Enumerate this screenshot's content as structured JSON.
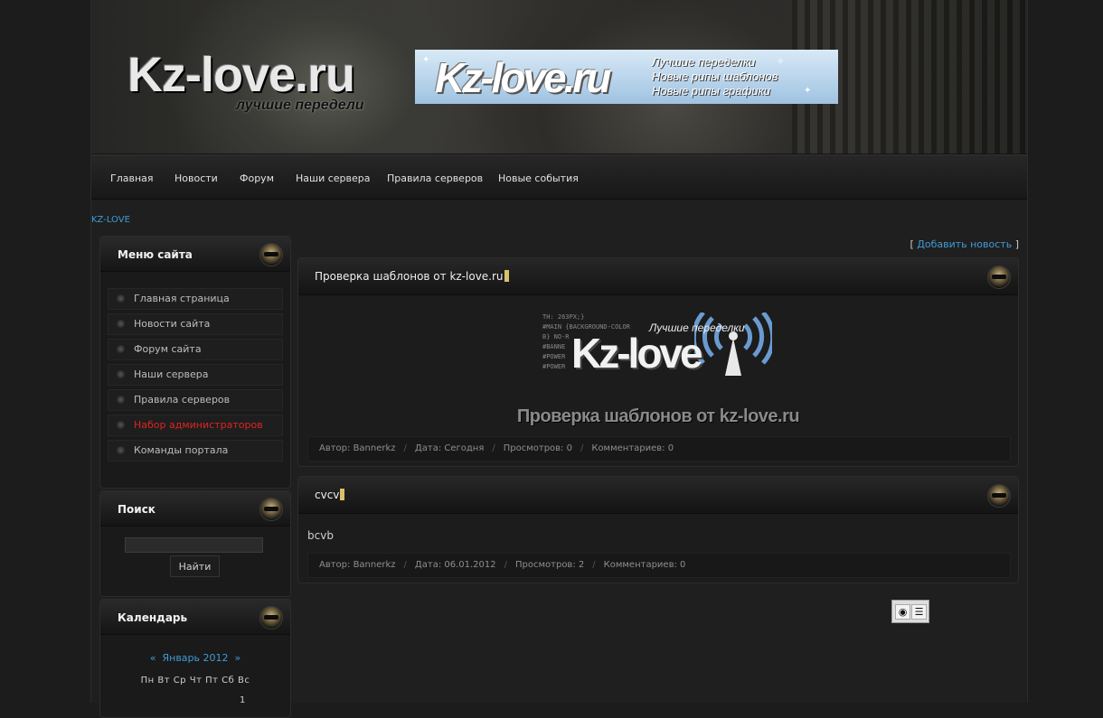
{
  "header": {
    "logo_text": "Kz-love.ru",
    "logo_subtitle": "лучшие передели",
    "banner": {
      "logo_text": "Kz-love.ru",
      "lines": [
        "Лучшие переделки",
        "Новые рипы шаблонов",
        "Новые рипы графики"
      ]
    }
  },
  "nav": {
    "items": [
      "Главная",
      "Новости",
      "Форум",
      "Наши сервера",
      "Правила серверов",
      "Новые события"
    ]
  },
  "breadcrumb": "KZ-LOVE",
  "sidebar": {
    "menu": {
      "title": "Меню сайта",
      "items": [
        {
          "label": "Главная страница"
        },
        {
          "label": "Новости сайта"
        },
        {
          "label": "Форум сайта"
        },
        {
          "label": "Наши сервера"
        },
        {
          "label": "Правила серверов"
        },
        {
          "label": "Набор администраторов",
          "color": "#e0241f"
        },
        {
          "label": "Команды портала"
        }
      ]
    },
    "search": {
      "title": "Поиск",
      "input_value": "",
      "button_label": "Найти"
    },
    "calendar": {
      "title": "Календарь",
      "prev": "«",
      "month": "Январь 2012",
      "next": "»",
      "weekdays": "Пн Вт Ср Чт Пт Сб Вс",
      "first_day": "1"
    }
  },
  "main": {
    "add_news_label": "Добавить новость",
    "posts": [
      {
        "title": "Проверка шаблонов от kz-love.ru",
        "image": {
          "logo": "Kz-love",
          "tagline": "Лучшие переделки",
          "code_lines": [
            "TH: 263PX;}",
            "#MAIN {BACKGROUND-COLOR",
            "B} NO-R",
            "#BANNE",
            "#POWER",
            "#POWER"
          ],
          "headline": "Проверка шаблонов от kz-love.ru"
        },
        "meta": {
          "author": "Автор: Bannerkz",
          "date": "Дата: Сегодня",
          "views": "Просмотров: 0",
          "comments": "Комментариев: 0"
        }
      },
      {
        "title": "cvcv",
        "body": "bcvb",
        "meta": {
          "author": "Автор: Bannerkz",
          "date": "Дата: 06.01.2012",
          "views": "Просмотров: 2",
          "comments": "Комментариев: 0"
        }
      }
    ]
  },
  "colors": {
    "accent_link": "#3f9bd6",
    "highlight_red": "#e0241f",
    "background": "#1c1c1c"
  },
  "icons": [
    "mask-icon",
    "eye-icon",
    "document-icon",
    "bullet-icon"
  ]
}
